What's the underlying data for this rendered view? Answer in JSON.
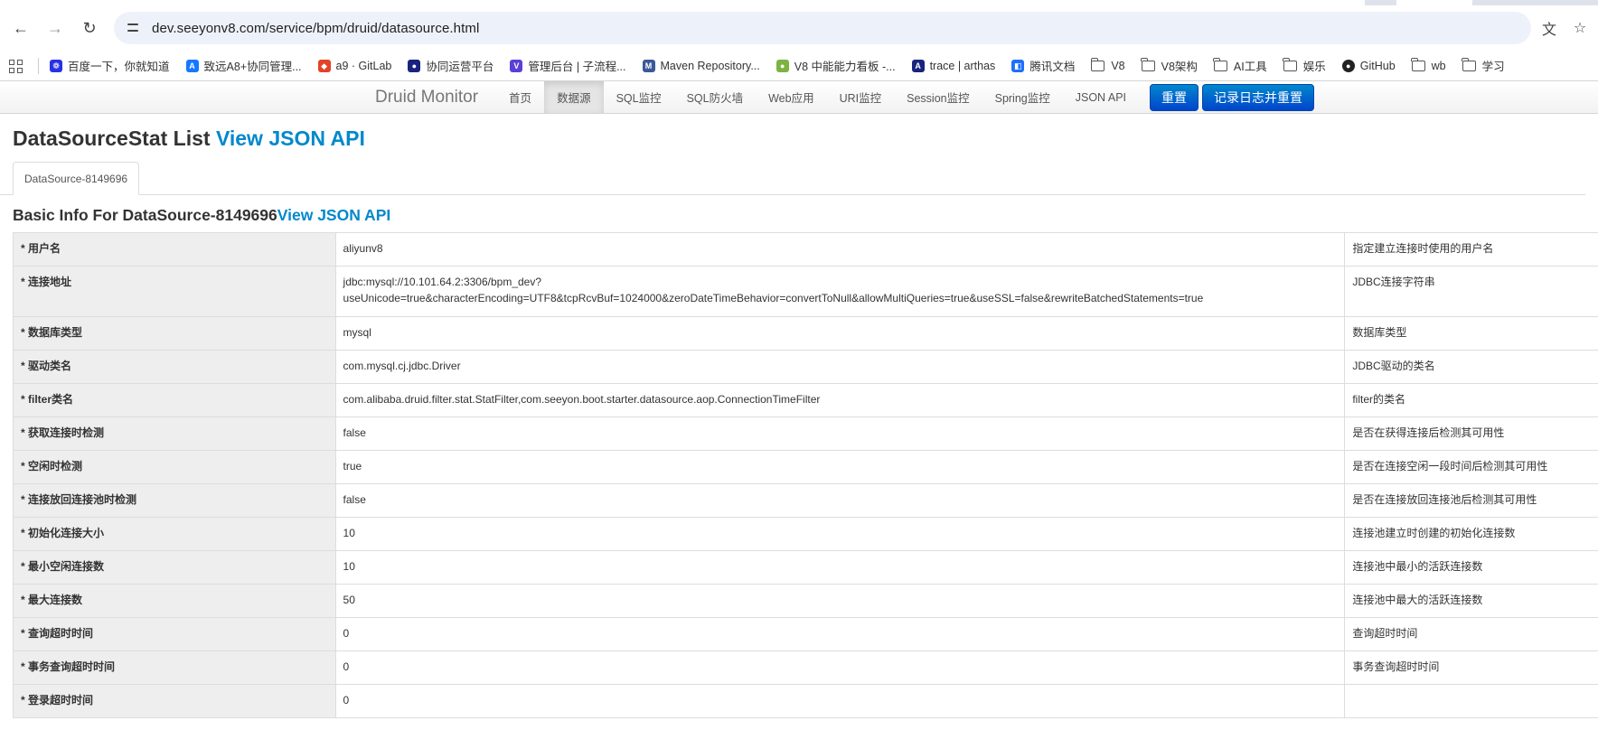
{
  "browser": {
    "url": "dev.seeyonv8.com/service/bpm/druid/datasource.html"
  },
  "bookmarks": [
    {
      "label": "百度一下，你就知道",
      "color": "#2932e1",
      "glyph": "❁"
    },
    {
      "label": "致远A8+协同管理...",
      "color": "#1677ff",
      "glyph": "A"
    },
    {
      "label": "a9 · GitLab",
      "color": "#e24329",
      "glyph": "◆"
    },
    {
      "label": "协同运营平台",
      "color": "#1a237e",
      "glyph": "●"
    },
    {
      "label": "管理后台 | 子流程...",
      "color": "#5b3fd6",
      "glyph": "V"
    },
    {
      "label": "Maven Repository...",
      "color": "#3b5998",
      "glyph": "M"
    },
    {
      "label": "V8 中能能力看板 -...",
      "color": "#7cb342",
      "glyph": "●"
    },
    {
      "label": "trace | arthas",
      "color": "#1a237e",
      "glyph": "A"
    },
    {
      "label": "腾讯文档",
      "color": "#1e6fff",
      "glyph": "◧"
    }
  ],
  "bookmark_folders": [
    "V8",
    "V8架构",
    "AI工具",
    "娱乐"
  ],
  "bookmark_github": "GitHub",
  "bookmark_folders_tail": [
    "wb",
    "学习"
  ],
  "nav": {
    "brand": "Druid Monitor",
    "items": [
      "首页",
      "数据源",
      "SQL监控",
      "SQL防火墙",
      "Web应用",
      "URI监控",
      "Session监控",
      "Spring监控",
      "JSON API"
    ],
    "active_index": 1,
    "reset_label": "重置",
    "reset_log_label": "记录日志并重置"
  },
  "page": {
    "title": "DataSourceStat List ",
    "title_link": "View JSON API",
    "tab_label": "DataSource-8149696",
    "basic_title": "Basic Info For DataSource-8149696",
    "basic_link": "View JSON API"
  },
  "rows": [
    {
      "key": "* 用户名",
      "value": "aliyunv8",
      "desc": "指定建立连接时使用的用户名"
    },
    {
      "key": "* 连接地址",
      "value": "jdbc:mysql://10.101.64.2:3306/bpm_dev?",
      "value2": "useUnicode=true&characterEncoding=UTF8&tcpRcvBuf=1024000&zeroDateTimeBehavior=convertToNull&allowMultiQueries=true&useSSL=false&rewriteBatchedStatements=true",
      "desc": "JDBC连接字符串"
    },
    {
      "key": "* 数据库类型",
      "value": "mysql",
      "desc": "数据库类型"
    },
    {
      "key": "* 驱动类名",
      "value": "com.mysql.cj.jdbc.Driver",
      "desc": "JDBC驱动的类名"
    },
    {
      "key": "* filter类名",
      "value": "com.alibaba.druid.filter.stat.StatFilter,com.seeyon.boot.starter.datasource.aop.ConnectionTimeFilter",
      "desc": "filter的类名"
    },
    {
      "key": "* 获取连接时检测",
      "value": "false",
      "desc": "是否在获得连接后检测其可用性"
    },
    {
      "key": "* 空闲时检测",
      "value": "true",
      "desc": "是否在连接空闲一段时间后检测其可用性"
    },
    {
      "key": "* 连接放回连接池时检测",
      "value": "false",
      "desc": "是否在连接放回连接池后检测其可用性"
    },
    {
      "key": "* 初始化连接大小",
      "value": "10",
      "desc": "连接池建立时创建的初始化连接数"
    },
    {
      "key": "* 最小空闲连接数",
      "value": "10",
      "desc": "连接池中最小的活跃连接数"
    },
    {
      "key": "* 最大连接数",
      "value": "50",
      "desc": "连接池中最大的活跃连接数"
    },
    {
      "key": "* 查询超时时间",
      "value": "0",
      "desc": "查询超时时间"
    },
    {
      "key": "* 事务查询超时时间",
      "value": "0",
      "desc": "事务查询超时时间"
    },
    {
      "key": "* 登录超时时间",
      "value": "0",
      "desc": ""
    }
  ]
}
